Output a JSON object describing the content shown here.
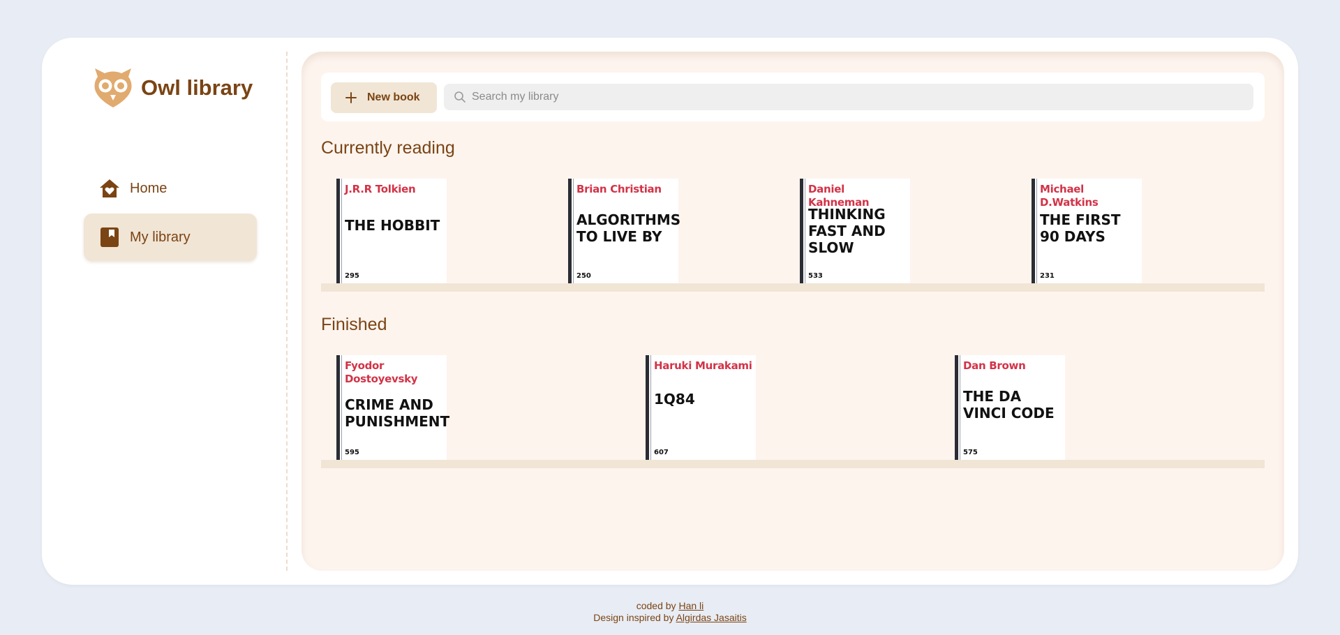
{
  "app": {
    "title": "Owl library"
  },
  "sidebar": {
    "items": [
      {
        "label": "Home",
        "icon": "home-heart-icon",
        "active": false
      },
      {
        "label": "My library",
        "icon": "bookmark-book-icon",
        "active": true
      }
    ]
  },
  "toolbar": {
    "new_book_label": "New book",
    "search_placeholder": "Search my library",
    "search_value": ""
  },
  "sections": {
    "reading": {
      "title": "Currently reading",
      "books": [
        {
          "author": "J.R.R Tolkien",
          "title": "THE HOBBIT",
          "pages": "295"
        },
        {
          "author": "Brian Christian",
          "title": "ALGORITHMS TO LIVE BY",
          "pages": "250"
        },
        {
          "author": "Daniel Kahneman",
          "title": "THINKING FAST AND SLOW",
          "pages": "533"
        },
        {
          "author": "Michael D.Watkins",
          "title": "THE FIRST 90 DAYS",
          "pages": "231"
        }
      ]
    },
    "finished": {
      "title": "Finished",
      "books": [
        {
          "author": "Fyodor Dostoyevsky",
          "title": "CRIME AND PUNISHMENT",
          "pages": "595"
        },
        {
          "author": "Haruki Murakami",
          "title": "1Q84",
          "pages": "607"
        },
        {
          "author": "Dan Brown",
          "title": "THE DA VINCI CODE",
          "pages": "575"
        }
      ]
    }
  },
  "footer": {
    "coded_by_prefix": "coded by",
    "coded_by_link": "Han li",
    "inspired_prefix": "Design inspired by",
    "inspired_link": "Algirdas Jasaitis"
  },
  "colors": {
    "brand": "#7a4414",
    "accent_light": "#f1e5d5",
    "author_red": "#d23347",
    "logo_owl": "#e1aa6e",
    "page_bg": "#e8ecf4",
    "main_bg": "#fdf4ee"
  }
}
